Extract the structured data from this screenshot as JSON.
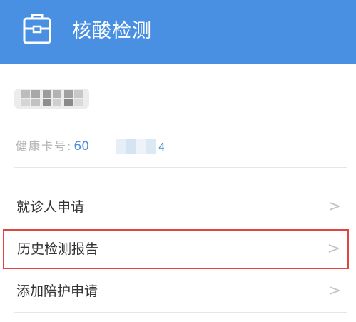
{
  "header": {
    "title": "核酸检测",
    "icon": "briefcase-icon",
    "background": "#4a90e2"
  },
  "profile": {
    "name_masked": true,
    "card_label": "健康卡号:",
    "card_value_visible": "60",
    "card_value_tail": "4",
    "card_value_color": "#4a8fd9"
  },
  "menu": {
    "items": [
      {
        "label": "就诊人申请",
        "chevron": ">"
      },
      {
        "label": "历史检测报告",
        "chevron": ">",
        "highlighted": true,
        "highlight_color": "#e2453e"
      },
      {
        "label": "添加陪护申请",
        "chevron": ">"
      }
    ]
  }
}
